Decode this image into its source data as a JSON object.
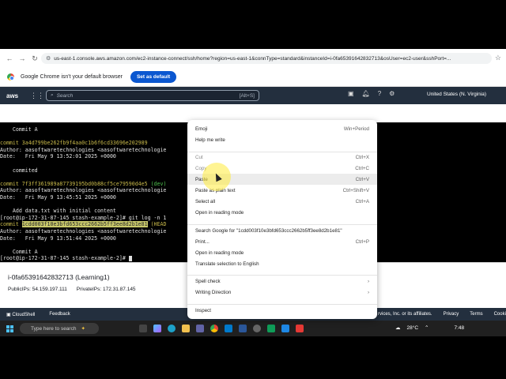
{
  "browser": {
    "url": "us-east-1.console.aws.amazon.com/ec2-instance-connect/ssh/home?region=us-east-1&connType=standard&instanceId=i-0fa65391642832713&osUser=ec2-user&sshPort=...",
    "infobar_text": "Google Chrome isn't your default browser",
    "set_default_label": "Set as default"
  },
  "aws": {
    "logo": "aws",
    "search_placeholder": "Search",
    "search_shortcut": "[Alt+S]",
    "region": "United States (N. Virginia)"
  },
  "terminal": {
    "lines": [
      {
        "text": "    Commit A",
        "color": "plain"
      },
      {
        "text": "",
        "color": "plain"
      },
      {
        "text": "commit 3a4d799be262fb9f4aa0c1b6f6cd33696e202989",
        "color": "yellow"
      },
      {
        "text": "Author: aasoftwaretechnologies <aasoftwaretechnologie",
        "color": "plain"
      },
      {
        "text": "Date:   Fri May 9 13:52:01 2025 +0000",
        "color": "plain"
      },
      {
        "text": "",
        "color": "plain"
      },
      {
        "text": "    commited",
        "color": "plain"
      },
      {
        "text": "",
        "color": "plain"
      },
      {
        "text": "commit 7f3ff361989a87739195bd0b88cf5ce79590d4e5 (dev)",
        "color": "yellow"
      },
      {
        "text": "Author: aasoftwaretechnologies <aasoftwaretechnologie",
        "color": "plain"
      },
      {
        "text": "Date:   Fri May 9 13:45:51 2025 +0000",
        "color": "plain"
      },
      {
        "text": "",
        "color": "plain"
      },
      {
        "text": "    Add data.txt with initial content",
        "color": "plain"
      },
      {
        "text": "[root@ip-172-31-87-145 stash-example-2]# git log -n 1",
        "color": "plain"
      },
      {
        "text": "commit 1cdd003f10e3bfd653ccc2662b5ff3ee8d2b1e81 (HEAD",
        "color": "selected"
      },
      {
        "text": "Author: aasoftwaretechnologies <aasoftwaretechnologie",
        "color": "plain"
      },
      {
        "text": "Date:   Fri May 9 13:51:44 2025 +0000",
        "color": "plain"
      },
      {
        "text": "",
        "color": "plain"
      },
      {
        "text": "    Commit A",
        "color": "plain"
      },
      {
        "text": "[root@ip-172-31-87-145 stash-example-2]# ",
        "color": "plain"
      }
    ]
  },
  "instance": {
    "title": "i-0fa65391642832713 (Learning1)",
    "public_ips": "PublicIPs: 54.159.197.111",
    "private_ips": "PrivateIPs: 172.31.87.145"
  },
  "footer": {
    "cloudshell": "CloudShell",
    "feedback": "Feedback",
    "copyright": "rvices, Inc. or its affiliates.",
    "privacy": "Privacy",
    "terms": "Terms",
    "cookie": "Cooki"
  },
  "taskbar": {
    "search_placeholder": "Type here to search",
    "temperature": "28°C",
    "time": "7:48"
  },
  "context_menu": {
    "items": [
      {
        "label": "Emoji",
        "shortcut": "Win+Period"
      },
      {
        "label": "Help me write",
        "shortcut": ""
      },
      {
        "label": "Cut",
        "shortcut": "Ctrl+X"
      },
      {
        "label": "Copy",
        "shortcut": "Ctrl+C"
      },
      {
        "label": "Paste",
        "shortcut": "Ctrl+V"
      },
      {
        "label": "Paste as plain text",
        "shortcut": "Ctrl+Shift+V"
      },
      {
        "label": "Select all",
        "shortcut": "Ctrl+A"
      },
      {
        "label": "Open in reading mode",
        "shortcut": ""
      },
      {
        "label": "Search Google for \"1cdd003f10e3bfd653ccc2662b5ff3ee8d2b1e81\"",
        "shortcut": ""
      },
      {
        "label": "Print...",
        "shortcut": "Ctrl+P"
      },
      {
        "label": "Open in reading mode",
        "shortcut": ""
      },
      {
        "label": "Translate selection to English",
        "shortcut": ""
      },
      {
        "label": "Spell check",
        "shortcut": "›"
      },
      {
        "label": "Writing Direction",
        "shortcut": "›"
      },
      {
        "label": "Inspect",
        "shortcut": ""
      }
    ]
  },
  "colors": {
    "aws_nav": "#232f3e",
    "chrome_blue": "#0b57d0",
    "terminal_commit": "#c8b94a",
    "terminal_branch": "#4fc14f"
  }
}
